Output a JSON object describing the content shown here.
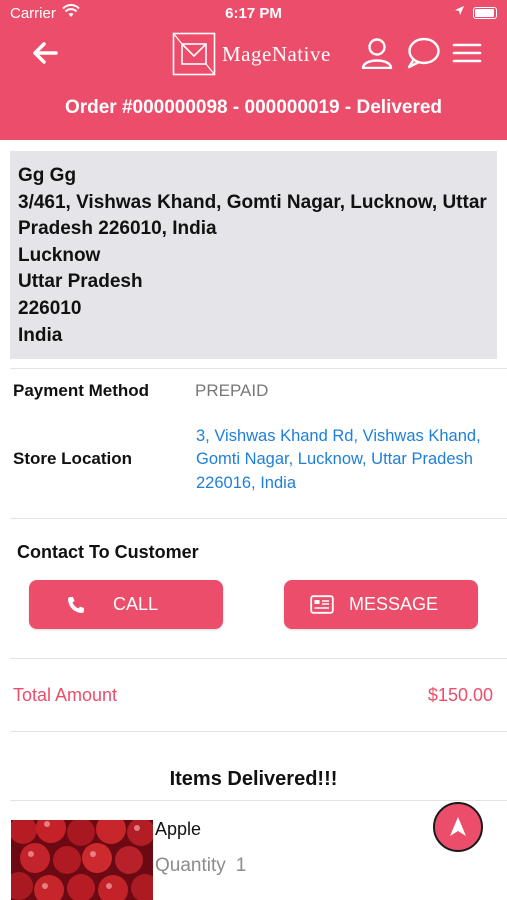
{
  "status_bar": {
    "carrier": "Carrier",
    "time": "6:17 PM"
  },
  "nav": {
    "brand": "MageNative"
  },
  "order": {
    "title": "Order #000000098 - 000000019 - Delivered"
  },
  "address": {
    "lines": [
      "Gg Gg",
      "3/461, Vishwas Khand, Gomti Nagar, Lucknow, Uttar",
      "Pradesh 226010, India",
      "Lucknow",
      "Uttar Pradesh",
      "226010",
      "India"
    ]
  },
  "payment": {
    "label": "Payment Method",
    "value": "PREPAID"
  },
  "store": {
    "label": "Store Location",
    "lines": [
      "3, Vishwas Khand Rd, Vishwas Khand,",
      "Gomti Nagar, Lucknow, Uttar Pradesh",
      "226016, India"
    ]
  },
  "contact": {
    "title": "Contact To Customer",
    "call_label": "CALL",
    "message_label": "MESSAGE"
  },
  "total": {
    "label": "Total Amount",
    "value": "$150.00"
  },
  "items": {
    "title": "Items Delivered!!!",
    "list": [
      {
        "name": "Apple",
        "quantity_label": "Quantity",
        "quantity": "1"
      }
    ]
  },
  "colors": {
    "accent": "#ec4d6a",
    "link": "#1e7fd8",
    "address_bg": "#e4e4e9"
  },
  "icons": [
    "wifi-icon",
    "location-arrow-icon",
    "battery-icon",
    "back-arrow-icon",
    "user-icon",
    "chat-icon",
    "menu-icon",
    "phone-icon",
    "message-card-icon",
    "navigation-icon"
  ]
}
